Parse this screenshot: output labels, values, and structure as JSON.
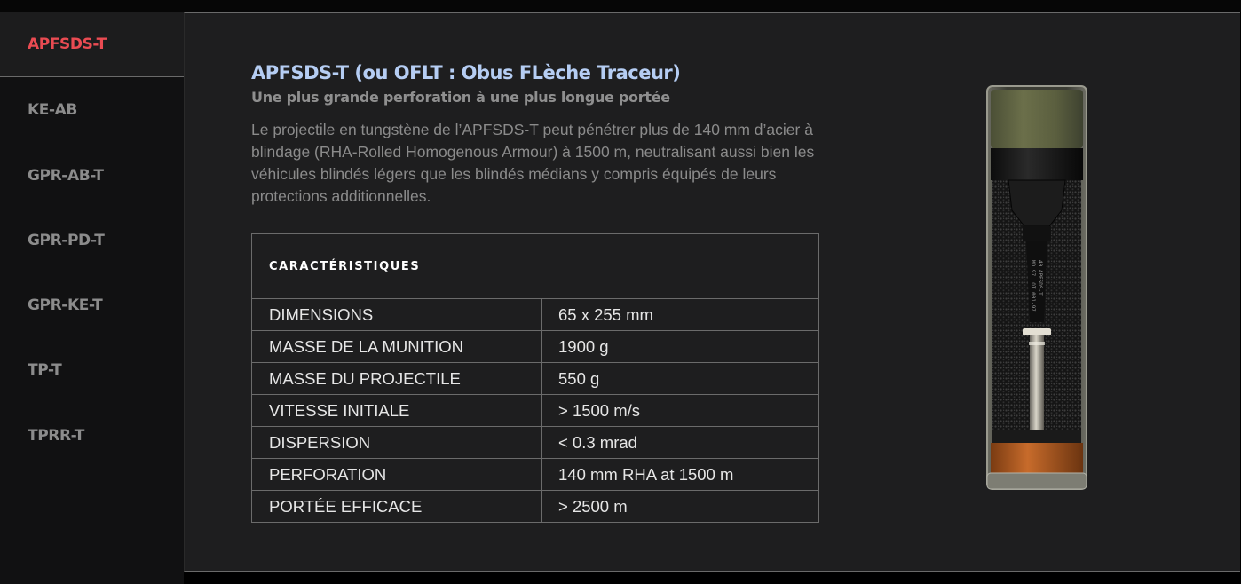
{
  "tabs": [
    {
      "label": "APFSDS-T",
      "active": true
    },
    {
      "label": "KE-AB",
      "active": false
    },
    {
      "label": "GPR-AB-T",
      "active": false
    },
    {
      "label": "GPR-PD-T",
      "active": false
    },
    {
      "label": "GPR-KE-T",
      "active": false
    },
    {
      "label": "TP-T",
      "active": false
    },
    {
      "label": "TPRR-T",
      "active": false
    }
  ],
  "product": {
    "title": "APFSDS-T (ou OFLT : Obus FLèche Traceur)",
    "subtitle": "Une plus grande perforation à une plus longue portée",
    "description": "Le projectile en tungstène de l’APFSDS-T peut pénétrer plus de 140 mm d’acier à blindage (RHA-Rolled Homogenous Armour) à 1500 m, neutralisant aussi bien les véhicules blindés légers que les blindés médians y compris équipés de leurs protections additionnelles.",
    "image_label": [
      "40 APFSDS-T",
      "MD 97 LOT 001-97"
    ]
  },
  "specs": {
    "heading": "CARACTÉRISTIQUES",
    "rows": [
      {
        "key": "DIMENSIONS",
        "value": "65 x 255 mm"
      },
      {
        "key": "MASSE DE LA MUNITION",
        "value": "1900 g"
      },
      {
        "key": "MASSE DU PROJECTILE",
        "value": "550 g"
      },
      {
        "key": "VITESSE INITIALE",
        "value": "> 1500 m/s"
      },
      {
        "key": "DISPERSION",
        "value": "< 0.3 mrad"
      },
      {
        "key": "PERFORATION",
        "value": "140 mm RHA at 1500 m"
      },
      {
        "key": "PORTÉE EFFICACE",
        "value": "> 2500 m"
      }
    ]
  },
  "colors": {
    "active_tab": "#ea4b52",
    "inactive_tab": "#8c8c8c",
    "title": "#b5cdf3",
    "panel_bg": "#1e1e1f",
    "sidebar_bg": "#111112"
  }
}
